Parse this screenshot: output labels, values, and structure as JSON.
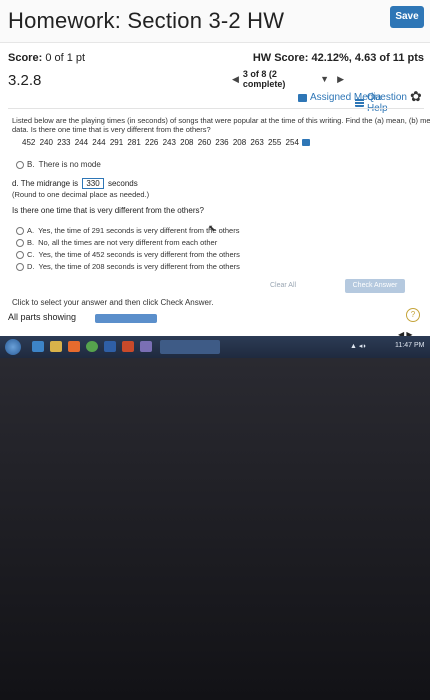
{
  "header": {
    "title": "Homework: Section 3-2 HW",
    "save_label": "Save"
  },
  "score": {
    "label": "Score:",
    "value": "0 of 1 pt",
    "hw_score": "HW Score: 42.12%, 4.63 of 11 pts"
  },
  "question": {
    "number": "3.2.8",
    "nav_text": "3 of 8 (2 complete)",
    "assigned_media": "Assigned Media",
    "question_help": "Question Help",
    "problem_line1": "Listed below are the playing times (in seconds) of songs that were popular at the time of this writing. Find the (a) mean, (b) median, (c) mode, and (d) midrange for the given sample",
    "problem_line2": "data. Is there one time that is very different from the others?",
    "data_values": "452 240 233 244 244 291 281 226 243 208 260 236 208 263 255 254",
    "mode_option_letter": "B.",
    "mode_text": "There is no mode",
    "part_d_prefix": "d. The midrange is",
    "midrange_value": "330",
    "part_d_suffix": "seconds",
    "round_note": "(Round to one decimal place as needed.)",
    "sub_question": "Is there one time that is very different from the others?",
    "options": [
      {
        "letter": "A.",
        "text": "Yes, the time of 291 seconds is very different from the others"
      },
      {
        "letter": "B.",
        "text": "No, all the times are not very different from each other"
      },
      {
        "letter": "C.",
        "text": "Yes, the time of 452 seconds is very different from the others"
      },
      {
        "letter": "D.",
        "text": "Yes, the time of 208 seconds is very different from the others"
      }
    ],
    "instruction": "Click to select your answer and then click Check Answer.",
    "all_parts": "All parts showing",
    "clear_all": "Clear All",
    "check_answer": "Check Answer",
    "help_symbol": "?",
    "progress_fraction": 1.0
  },
  "taskbar": {
    "clock": "11:47 PM"
  },
  "colors": {
    "accent": "#2e76b6",
    "check_answer_disabled": "#b5c9df",
    "taskbar": "#2c3b55"
  },
  "icons": [
    "gear-icon",
    "question-help-icon",
    "assigned-media-icon",
    "data-table-icon",
    "start-icon"
  ]
}
